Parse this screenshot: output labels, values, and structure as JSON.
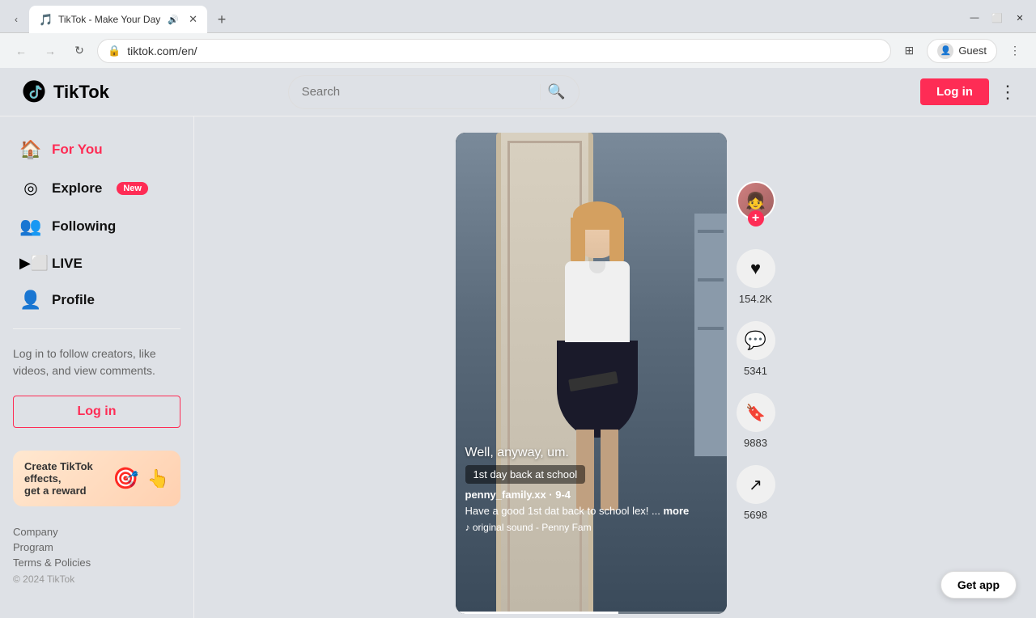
{
  "browser": {
    "tab_label": "TikTok - Make Your Day",
    "url": "tiktok.com/en/",
    "tab_favicon": "🎵"
  },
  "header": {
    "logo_text": "TikTok",
    "search_placeholder": "Search",
    "login_label": "Log in",
    "more_icon": "⋮"
  },
  "sidebar": {
    "nav_items": [
      {
        "id": "for-you",
        "icon": "🏠",
        "label": "For You",
        "active": true
      },
      {
        "id": "explore",
        "icon": "○",
        "label": "Explore",
        "badge": "New",
        "active": false
      },
      {
        "id": "following",
        "icon": "👤",
        "label": "Following",
        "active": false
      },
      {
        "id": "live",
        "icon": "📺",
        "label": "LIVE",
        "active": false
      },
      {
        "id": "profile",
        "icon": "👤",
        "label": "Profile",
        "active": false
      }
    ],
    "cta_text": "Log in to follow creators, like videos, and view comments.",
    "login_label": "Log in",
    "effects_banner_line1": "Create TikTok effects,",
    "effects_banner_line2": "get a reward",
    "footer_links": [
      "Company",
      "Program",
      "Terms & Policies"
    ],
    "copyright": "© 2024 TikTok"
  },
  "video": {
    "caption_main": "Well, anyway, um.",
    "tag": "1st day back at school",
    "username": "penny_family.xx · 9-4",
    "description": "Have a good 1st dat back to school lex! ...",
    "more_label": "more",
    "sound": "♪  original sound - Penny Fam",
    "likes": "154.2K",
    "comments": "5341",
    "bookmarks": "9883",
    "shares": "5698"
  },
  "cta": {
    "get_app_label": "Get app"
  }
}
